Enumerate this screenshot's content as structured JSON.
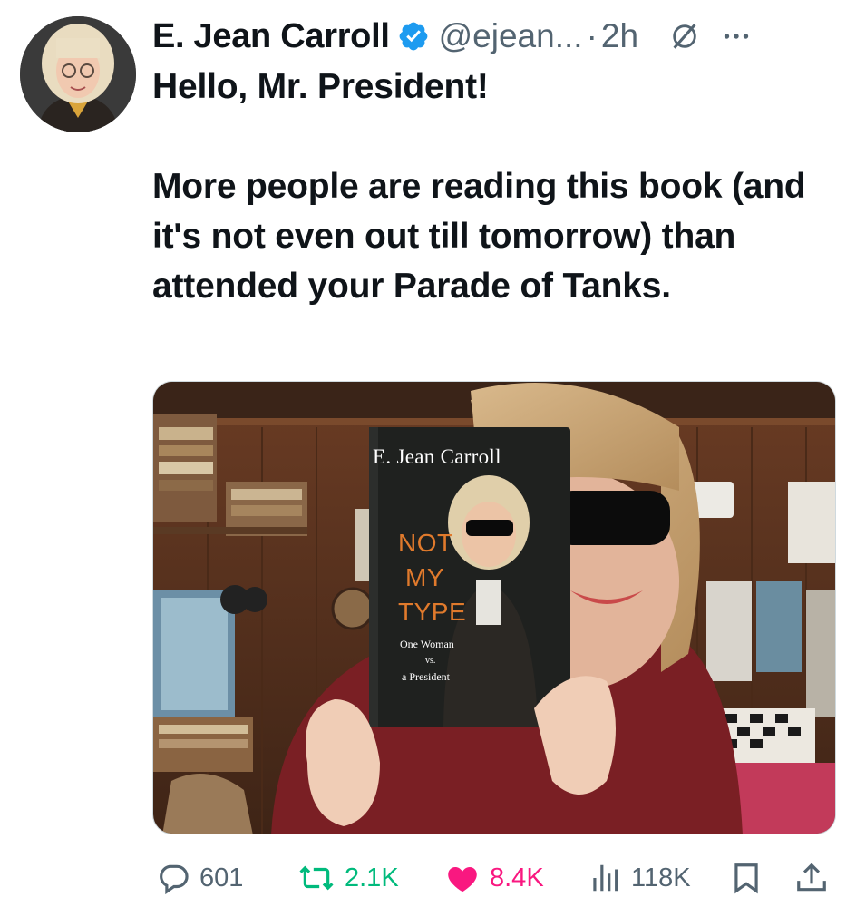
{
  "tweet": {
    "author_name": "E. Jean Carroll",
    "handle": "@ejean...",
    "separator": "·",
    "time": "2h",
    "text": "Hello, Mr. President!\n\nMore people are reading this book (and it's not even out till tomorrow) than attended your Parade of Tanks."
  },
  "book": {
    "author": "E. Jean Carroll",
    "title_lines": [
      "NOT",
      "MY",
      "TYPE"
    ],
    "subtitle_lines": [
      "One Woman",
      "vs.",
      "a President"
    ]
  },
  "actions": {
    "replies": "601",
    "retweets": "2.1K",
    "likes": "8.4K",
    "views": "118K"
  },
  "colors": {
    "verified": "#1d9bf0",
    "retweet": "#00ba7c",
    "like": "#f91880",
    "muted": "#536471"
  },
  "icons": [
    "verified-badge-icon",
    "grok-icon",
    "more-icon",
    "reply-icon",
    "retweet-icon",
    "like-icon",
    "views-icon",
    "bookmark-icon",
    "share-icon"
  ]
}
